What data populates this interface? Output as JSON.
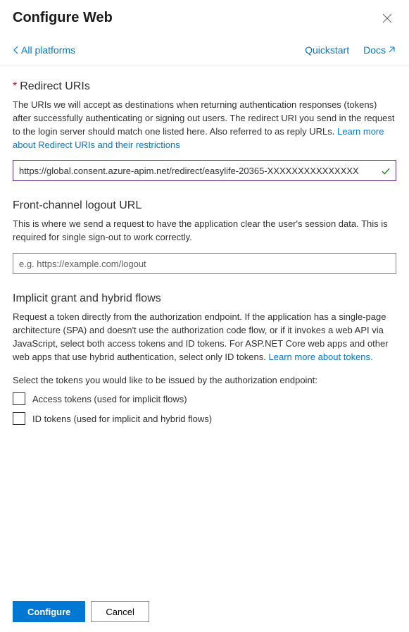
{
  "header": {
    "title": "Configure Web"
  },
  "subheader": {
    "back_label": "All platforms",
    "quickstart_label": "Quickstart",
    "docs_label": "Docs"
  },
  "redirect": {
    "title": "Redirect URIs",
    "desc_prefix": "The URIs we will accept as destinations when returning authentication responses (tokens) after successfully authenticating or signing out users. The redirect URI you send in the request to the login server should match one listed here. Also referred to as reply URLs. ",
    "link_text": "Learn more about Redirect URIs and their restrictions",
    "input_value": "https://global.consent.azure-apim.net/redirect/easylife-20365-XXXXXXXXXXXXXXX"
  },
  "logout": {
    "title": "Front-channel logout URL",
    "desc": "This is where we send a request to have the application clear the user's session data. This is required for single sign-out to work correctly.",
    "placeholder": "e.g. https://example.com/logout"
  },
  "implicit": {
    "title": "Implicit grant and hybrid flows",
    "desc_prefix": "Request a token directly from the authorization endpoint. If the application has a single-page architecture (SPA) and doesn't use the authorization code flow, or if it invokes a web API via JavaScript, select both access tokens and ID tokens. For ASP.NET Core web apps and other web apps that use hybrid authentication, select only ID tokens. ",
    "link_text": "Learn more about tokens.",
    "prompt": "Select the tokens you would like to be issued by the authorization endpoint:",
    "access_tokens_label": "Access tokens (used for implicit flows)",
    "id_tokens_label": "ID tokens (used for implicit and hybrid flows)"
  },
  "footer": {
    "configure_label": "Configure",
    "cancel_label": "Cancel"
  }
}
